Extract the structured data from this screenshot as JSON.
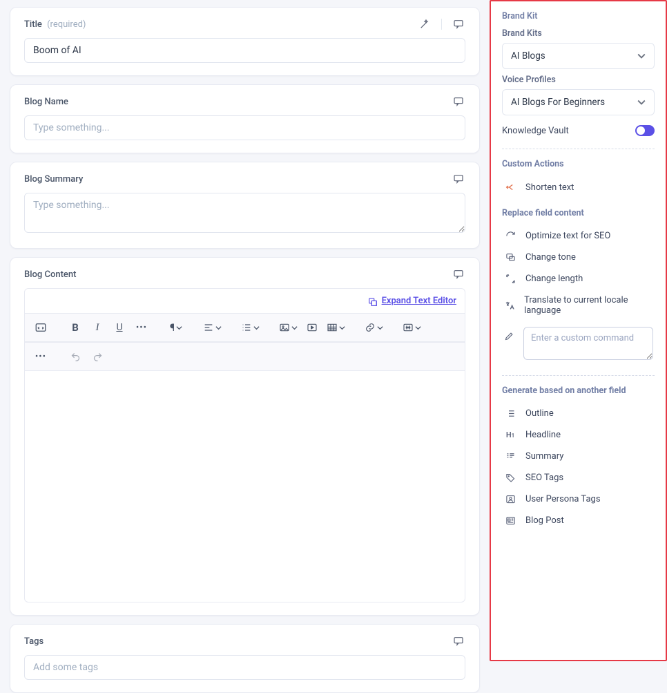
{
  "fields": {
    "title": {
      "label": "Title",
      "required_text": "(required)",
      "value": "Boom of AI"
    },
    "blogName": {
      "label": "Blog Name",
      "placeholder": "Type something..."
    },
    "blogSummary": {
      "label": "Blog Summary",
      "placeholder": "Type something..."
    },
    "blogContent": {
      "label": "Blog Content",
      "expand_text": "Expand Text Editor"
    },
    "tags": {
      "label": "Tags",
      "placeholder": "Add some tags"
    }
  },
  "sidebar": {
    "brandKit": {
      "heading": "Brand Kit",
      "brandKitsLabel": "Brand Kits",
      "brandKitsValue": "AI Blogs",
      "voiceLabel": "Voice Profiles",
      "voiceValue": "AI Blogs For Beginners",
      "knowledgeVault": "Knowledge Vault"
    },
    "customActions": {
      "heading": "Custom Actions",
      "shorten": "Shorten text"
    },
    "replace": {
      "heading": "Replace field content",
      "items": {
        "seo": "Optimize text for SEO",
        "tone": "Change tone",
        "length": "Change length",
        "translate": "Translate to current locale language"
      },
      "custom_placeholder": "Enter a custom command"
    },
    "generate": {
      "heading": "Generate based on another field",
      "items": {
        "outline": "Outline",
        "headline": "Headline",
        "summary": "Summary",
        "seotags": "SEO Tags",
        "persona": "User Persona Tags",
        "blogpost": "Blog Post"
      }
    }
  }
}
